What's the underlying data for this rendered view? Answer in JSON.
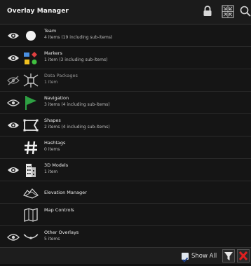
{
  "header": {
    "title": "Overlay Manager",
    "icons": [
      "lock-icon",
      "expand-collapse-icon",
      "search-icon"
    ]
  },
  "items": [
    {
      "name": "Team",
      "sub": "4 items (19 including sub-items)",
      "visibility": "visible",
      "icon": "team-circle-icon"
    },
    {
      "name": "Markers",
      "sub": "1 item (3 including sub-items)",
      "visibility": "visible",
      "icon": "markers-icon"
    },
    {
      "name": "Data Packages",
      "sub": "1 item",
      "visibility": "hidden",
      "icon": "data-packages-icon"
    },
    {
      "name": "Navigation",
      "sub": "3 items (4 including sub-items)",
      "visibility": "visible",
      "icon": "green-flag-icon"
    },
    {
      "name": "Shapes",
      "sub": "2 items (4 including sub-items)",
      "visibility": "visible",
      "icon": "shapes-icon"
    },
    {
      "name": "Hashtags",
      "sub": "0 items",
      "visibility": "none",
      "icon": "hashtag-icon"
    },
    {
      "name": "3D Models",
      "sub": "1 item",
      "visibility": "visible",
      "icon": "3d-models-icon"
    },
    {
      "name": "Elevation Manager",
      "sub": "",
      "visibility": "none",
      "icon": "elevation-icon"
    },
    {
      "name": "Map Controls",
      "sub": "",
      "visibility": "none",
      "icon": "map-controls-icon"
    },
    {
      "name": "Other Overlays",
      "sub": "5 items",
      "visibility": "visible",
      "icon": "other-overlays-icon"
    }
  ],
  "footer": {
    "show_all_label": "Show All",
    "show_all_checked": true,
    "buttons": [
      "filter-icon",
      "close-icon"
    ]
  },
  "colors": {
    "background": "#101010",
    "green_flag": "#2ea043",
    "close_red": "#e02020",
    "marker_blue": "#4a90e2",
    "marker_red": "#e04040",
    "marker_yellow": "#f0c020",
    "marker_green": "#40c040"
  }
}
